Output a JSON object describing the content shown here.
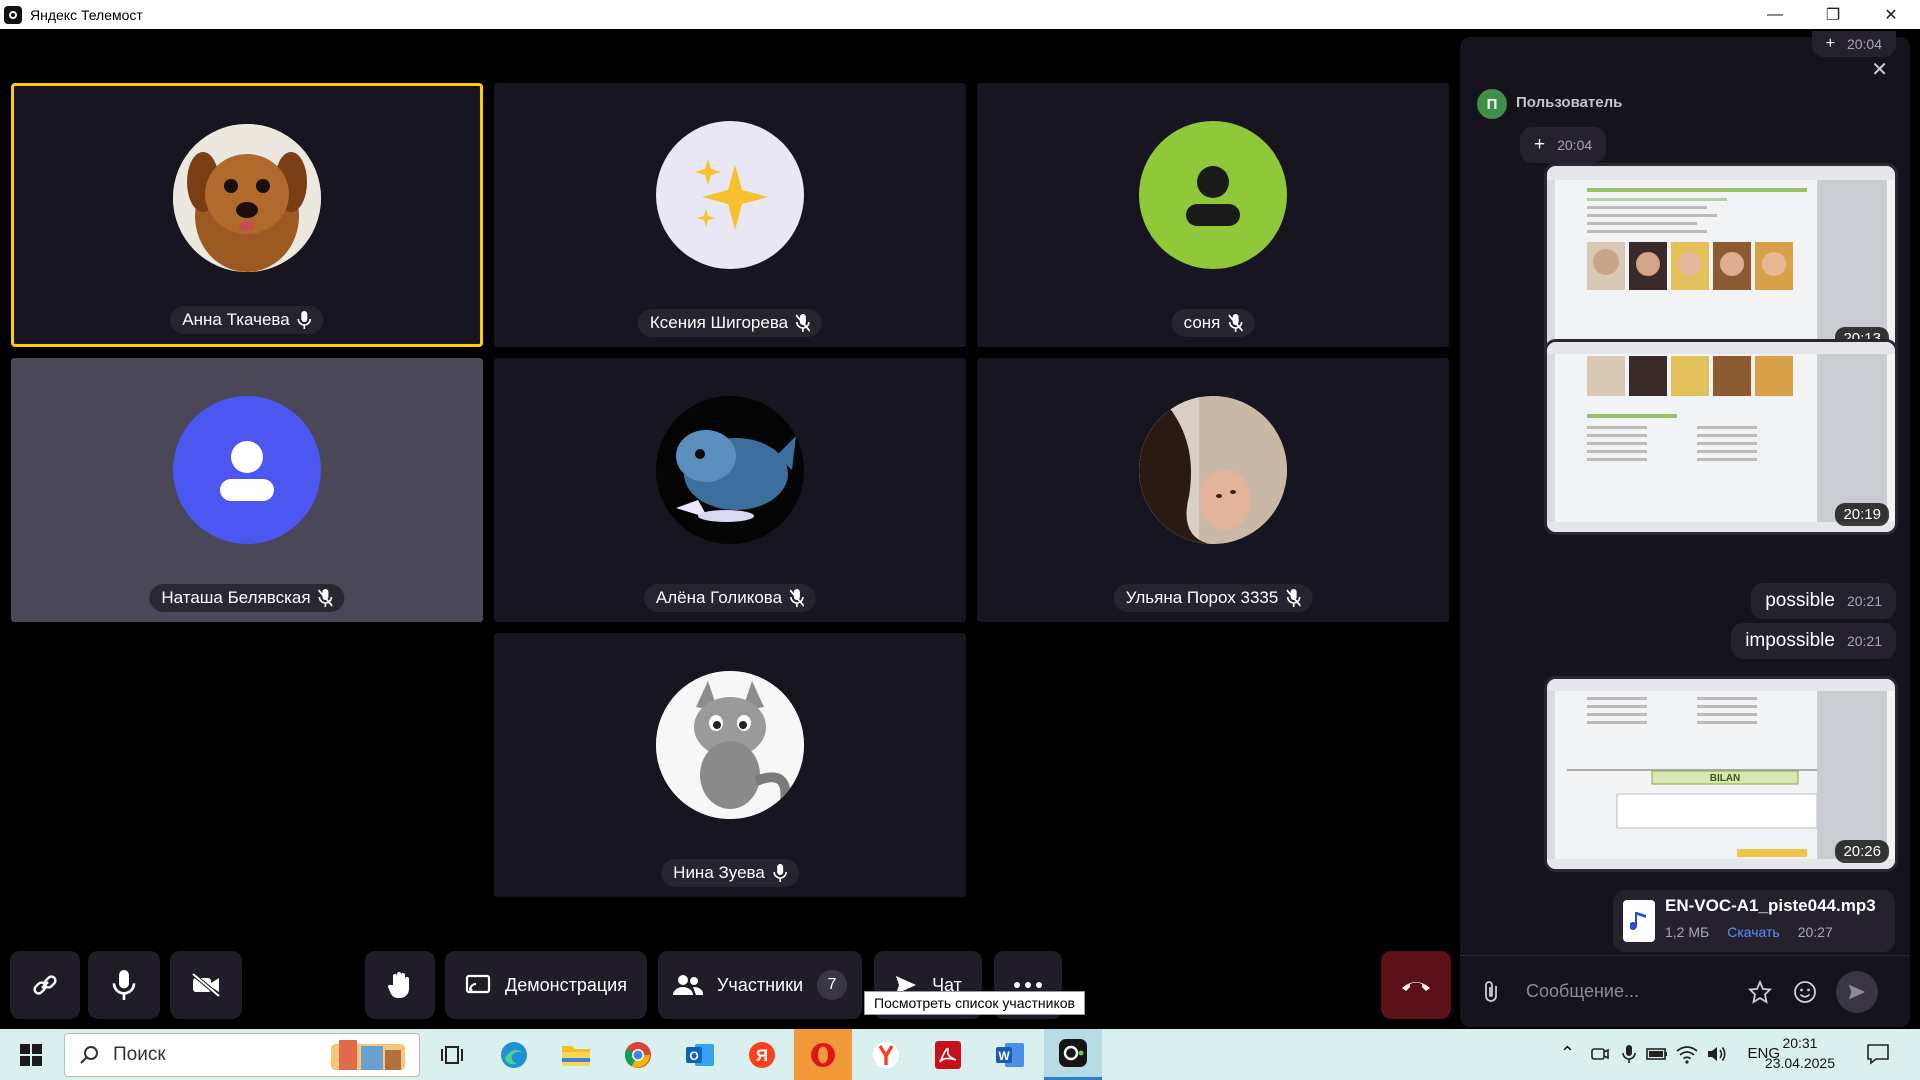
{
  "window": {
    "title": "Яндекс Телемост",
    "min": "—",
    "max": "❐",
    "close": "✕"
  },
  "participants": [
    {
      "name": "Анна Ткачева",
      "mic": "on"
    },
    {
      "name": "Ксения Шигорева",
      "mic": "off"
    },
    {
      "name": "соня",
      "mic": "off"
    },
    {
      "name": "Наташа Белявская",
      "mic": "off"
    },
    {
      "name": "Алёна Голикова",
      "mic": "off"
    },
    {
      "name": "Ульяна Порох 3335",
      "mic": "off"
    },
    {
      "name": "Нина Зуева",
      "mic": "on"
    }
  ],
  "toolbar": {
    "demo_label": "Демонстрация",
    "participants_label": "Участники",
    "participants_count": "7",
    "chat_label": "Чат",
    "tooltip": "Посмотреть список участников"
  },
  "chat": {
    "top_msg": {
      "text": "+",
      "time": "20:04"
    },
    "sender": {
      "initial": "П",
      "name": "Пользователь"
    },
    "plus_msg": {
      "text": "+",
      "time": "20:04"
    },
    "images": [
      {
        "time": "20:13"
      },
      {
        "time": "20:19"
      },
      {
        "time": "20:26",
        "caption": "BILAN"
      }
    ],
    "texts": [
      {
        "text": "possible",
        "time": "20:21"
      },
      {
        "text": "impossible",
        "time": "20:21"
      }
    ],
    "file": {
      "name": "EN-VOC-A1_piste044.mp3",
      "size": "1,2 МБ",
      "action": "Скачать",
      "time": "20:27"
    },
    "placeholder": "Сообщение..."
  },
  "taskbar": {
    "search_label": "Поиск",
    "lang": "ENG",
    "time": "20:31",
    "date": "23.04.2025"
  },
  "colors": {
    "active_border": "#ffcc00",
    "hangup": "#5c1018",
    "tile_bg": "#171520"
  }
}
